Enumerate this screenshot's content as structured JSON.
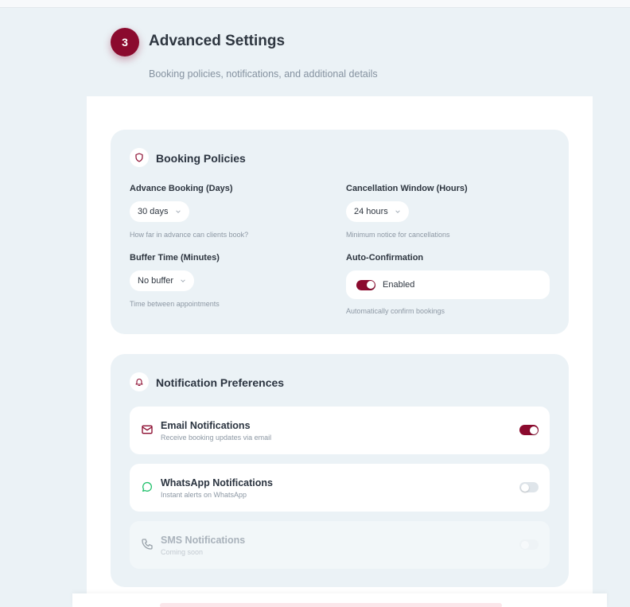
{
  "header": {
    "step_number": "3",
    "title": "Advanced Settings",
    "subtitle": "Booking policies, notifications, and additional details"
  },
  "booking_policies": {
    "title": "Booking Policies",
    "icon": "shield-icon",
    "advance_booking": {
      "label": "Advance Booking (Days)",
      "value": "30 days",
      "hint": "How far in advance can clients book?"
    },
    "cancellation_window": {
      "label": "Cancellation Window (Hours)",
      "value": "24 hours",
      "hint": "Minimum notice for cancellations"
    },
    "buffer_time": {
      "label": "Buffer Time (Minutes)",
      "value": "No buffer",
      "hint": "Time between appointments"
    },
    "auto_confirmation": {
      "label": "Auto-Confirmation",
      "status": "Enabled",
      "enabled": true,
      "hint": "Automatically confirm bookings"
    }
  },
  "notifications": {
    "title": "Notification Preferences",
    "icon": "bell-icon",
    "items": [
      {
        "title": "Email Notifications",
        "desc": "Receive booking updates via email",
        "enabled": true,
        "icon": "mail-icon"
      },
      {
        "title": "WhatsApp Notifications",
        "desc": "Instant alerts on WhatsApp",
        "enabled": false,
        "icon": "whatsapp-icon"
      },
      {
        "title": "SMS Notifications",
        "desc": "Coming soon",
        "enabled": false,
        "disabled": true,
        "icon": "phone-icon"
      }
    ]
  },
  "colors": {
    "accent": "#8b0a2e",
    "background": "#ebf2f6",
    "whatsapp": "#25c26e"
  }
}
